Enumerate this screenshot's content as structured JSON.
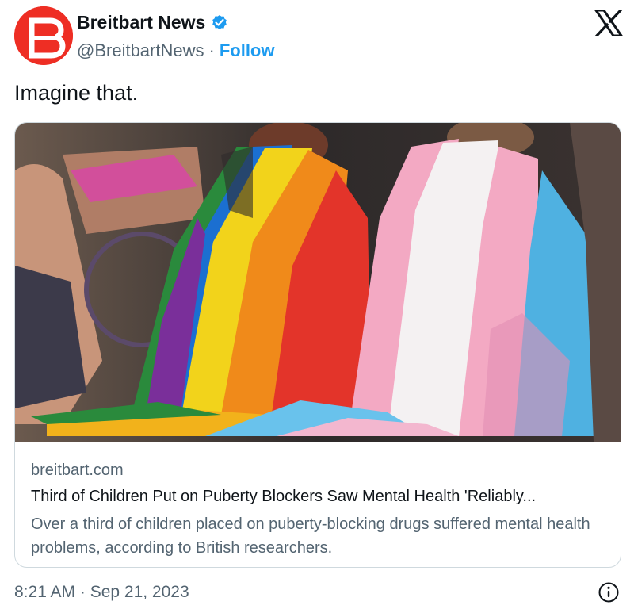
{
  "author": {
    "display_name": "Breitbart News",
    "handle": "@BreitbartNews",
    "separator": "·",
    "follow_label": "Follow",
    "avatar_letter": "B",
    "verified": true
  },
  "tweet": {
    "text": "Imagine that."
  },
  "card": {
    "domain": "breitbart.com",
    "title": "Third of Children Put on Puberty Blockers Saw Mental Health 'Reliably...",
    "description": "Over a third of children placed on puberty-blocking drugs suffered mental health problems, according to British researchers."
  },
  "footer": {
    "timestamp": "8:21 AM · Sep 21, 2023"
  },
  "colors": {
    "brand_red": "#ee2e24",
    "link_blue": "#1d9bf0",
    "secondary_text": "#536471",
    "border": "#cfd9de"
  },
  "icons": {
    "verified": "verified-badge-icon",
    "platform": "x-logo-icon",
    "info": "info-icon"
  }
}
